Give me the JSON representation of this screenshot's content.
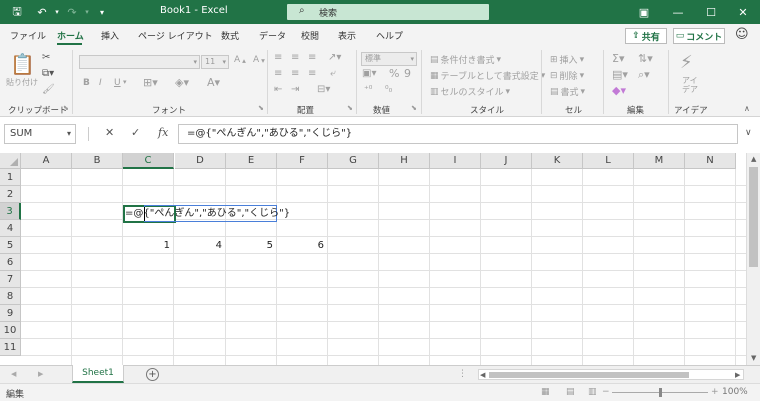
{
  "window": {
    "title": "Book1  -  Excel",
    "search_placeholder": "検索"
  },
  "tabs": [
    {
      "label": "ファイル",
      "active": false
    },
    {
      "label": "ホーム",
      "active": true
    },
    {
      "label": "挿入",
      "active": false
    },
    {
      "label": "ページ レイアウト",
      "active": false
    },
    {
      "label": "数式",
      "active": false
    },
    {
      "label": "データ",
      "active": false
    },
    {
      "label": "校閲",
      "active": false
    },
    {
      "label": "表示",
      "active": false
    },
    {
      "label": "ヘルプ",
      "active": false
    }
  ],
  "header_buttons": {
    "share": "共有",
    "comment": "コメント"
  },
  "ribbon": {
    "clipboard": {
      "label": "クリップボード",
      "paste": "貼り付け"
    },
    "font": {
      "label": "フォント",
      "size": "11",
      "bold": "B",
      "italic": "I",
      "underline": "U"
    },
    "alignment": {
      "label": "配置"
    },
    "number": {
      "label": "数値",
      "format": "標準",
      "percent": "%",
      "comma": "9"
    },
    "styles": {
      "label": "スタイル",
      "conditional": "条件付き書式",
      "table": "テーブルとして書式設定",
      "cell_styles": "セルのスタイル"
    },
    "cells": {
      "label": "セル",
      "insert": "挿入",
      "delete": "削除",
      "format": "書式"
    },
    "editing": {
      "label": "編集"
    },
    "ideas": {
      "label": "アイデア",
      "button": "アイ\nデア"
    }
  },
  "formula_bar": {
    "name_box": "SUM",
    "cancel": "✕",
    "enter": "✓",
    "fx": "fx",
    "formula": "=@{\"ぺんぎん\",\"あひる\",\"くじら\"}"
  },
  "grid": {
    "columns": [
      "A",
      "B",
      "C",
      "D",
      "E",
      "F",
      "G",
      "H",
      "I",
      "J",
      "K",
      "L",
      "M",
      "N"
    ],
    "rows": [
      "1",
      "2",
      "3",
      "4",
      "5",
      "6",
      "7",
      "8",
      "9",
      "10",
      "11"
    ],
    "selected_column": "C",
    "selected_row": "3",
    "row5_values": [
      "1",
      "4",
      "5",
      "6"
    ],
    "edit_text": "=@{\"ぺんぎん\",\"あひる\",\"くじら\"}"
  },
  "sheets": {
    "active": "Sheet1"
  },
  "status": {
    "mode": "編集",
    "zoom": "100%"
  },
  "colors": {
    "accent": "#217346",
    "ref_border": "#4a7fd9"
  }
}
